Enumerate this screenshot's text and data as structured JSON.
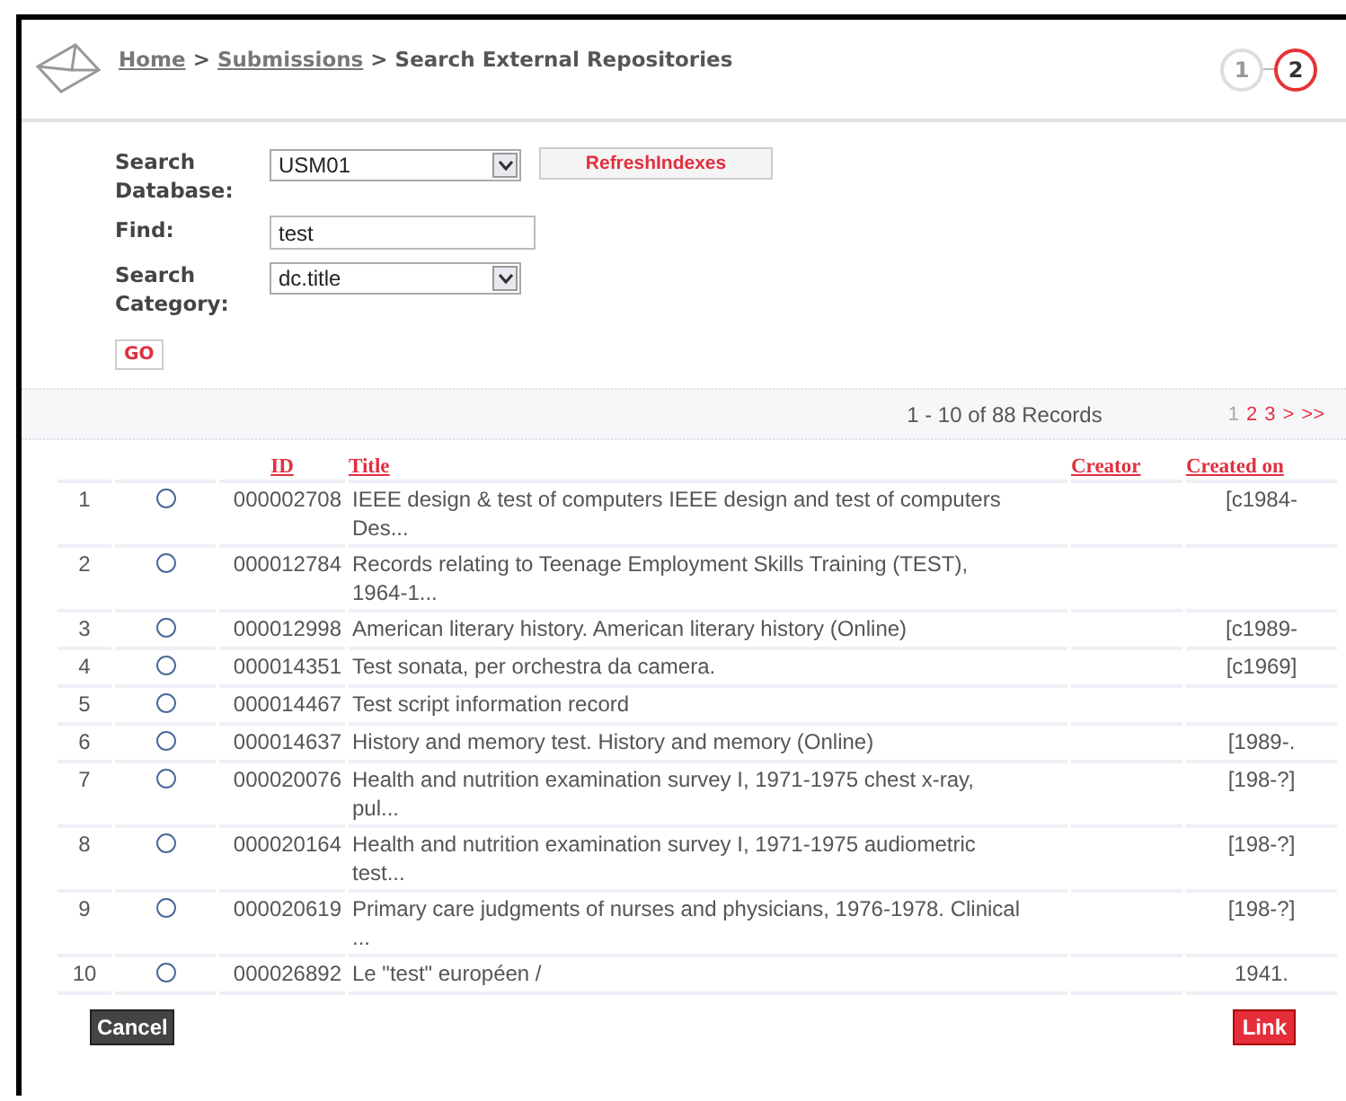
{
  "breadcrumb": [
    {
      "kind": "link",
      "label": "Home"
    },
    {
      "kind": "separator",
      "label": ">"
    },
    {
      "kind": "link",
      "label": "Submissions"
    },
    {
      "kind": "separator",
      "label": ">"
    },
    {
      "kind": "current",
      "label": "Search External Repositories"
    }
  ],
  "steps": [
    {
      "label": "1",
      "selected": false
    },
    {
      "label": "2",
      "selected": true
    }
  ],
  "form": {
    "database_label": "Search Database:",
    "database_value": "USM01",
    "refresh_button": "RefreshIndexes",
    "find_label": "Find:",
    "find_value": "test",
    "category_label": "Search Category:",
    "category_value": "dc.title",
    "go_button": "GO"
  },
  "records_summary": "1 - 10 of 88 Records",
  "pages": [
    {
      "label": "1",
      "selected": true
    },
    {
      "label": "2",
      "selected": false
    },
    {
      "label": "3",
      "selected": false
    },
    {
      "label": ">",
      "selected": false
    },
    {
      "label": ">>",
      "selected": false
    }
  ],
  "table": {
    "columns": [
      "ID",
      "Title",
      "Creator",
      "Created on"
    ],
    "rows": [
      {
        "num": "1",
        "selected": false,
        "id": "000002708",
        "title": [
          "IEEE design & test of computers IEEE design and test of computers",
          "Des..."
        ],
        "created": "[c1984-"
      },
      {
        "num": "2",
        "selected": false,
        "id": "000012784",
        "title": [
          "Records relating to Teenage Employment Skills Training (TEST),",
          "1964-1..."
        ],
        "created": ""
      },
      {
        "num": "3",
        "selected": false,
        "id": "000012998",
        "title": [
          "American literary history. American literary history (Online)"
        ],
        "created": "[c1989-"
      },
      {
        "num": "4",
        "selected": false,
        "id": "000014351",
        "title": [
          "Test sonata, per orchestra da camera."
        ],
        "created": "[c1969]"
      },
      {
        "num": "5",
        "selected": false,
        "id": "000014467",
        "title": [
          "Test script information record"
        ],
        "created": ""
      },
      {
        "num": "6",
        "selected": false,
        "id": "000014637",
        "title": [
          "History and memory test. History and memory (Online)"
        ],
        "created": "[1989-."
      },
      {
        "num": "7",
        "selected": false,
        "id": "000020076",
        "title": [
          "Health and nutrition examination survey I, 1971-1975 chest x-ray,",
          "pul..."
        ],
        "created": "[198-?]"
      },
      {
        "num": "8",
        "selected": false,
        "id": "000020164",
        "title": [
          "Health and nutrition examination survey I, 1971-1975 audiometric",
          "test..."
        ],
        "created": "[198-?]"
      },
      {
        "num": "9",
        "selected": false,
        "id": "000020619",
        "title": [
          "Primary care judgments of nurses and physicians, 1976-1978. Clinical",
          "..."
        ],
        "created": "[198-?]"
      },
      {
        "num": "10",
        "selected": false,
        "id": "000026892",
        "title": [
          "Le \"test\" européen /"
        ],
        "created": "1941."
      }
    ]
  },
  "cancel_button": "Cancel",
  "link_button": "Link"
}
